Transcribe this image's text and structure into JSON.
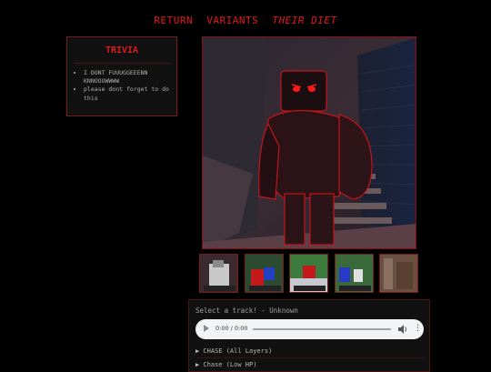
{
  "nav": {
    "return": "RETURN",
    "variants": "VARIANTS",
    "current": "THEIR DIET"
  },
  "trivia": {
    "title": "TRIVIA",
    "items": [
      "I DONT FUUUGGEEENN KNNOOOWWWW",
      "please dont forget to do this"
    ]
  },
  "gallery": {
    "main_image": "red-eyed-figure-render",
    "thumbnail_count": 5
  },
  "music": {
    "heading": "Select a track! - Unknown",
    "player": {
      "time": "0:00 / 0:00"
    },
    "tracks": [
      "▶ CHASE (All Layers)",
      "▶ Chase (Low HP)"
    ]
  },
  "colors": {
    "accent": "#e0191c",
    "background": "#000000",
    "panel": "#111111"
  }
}
